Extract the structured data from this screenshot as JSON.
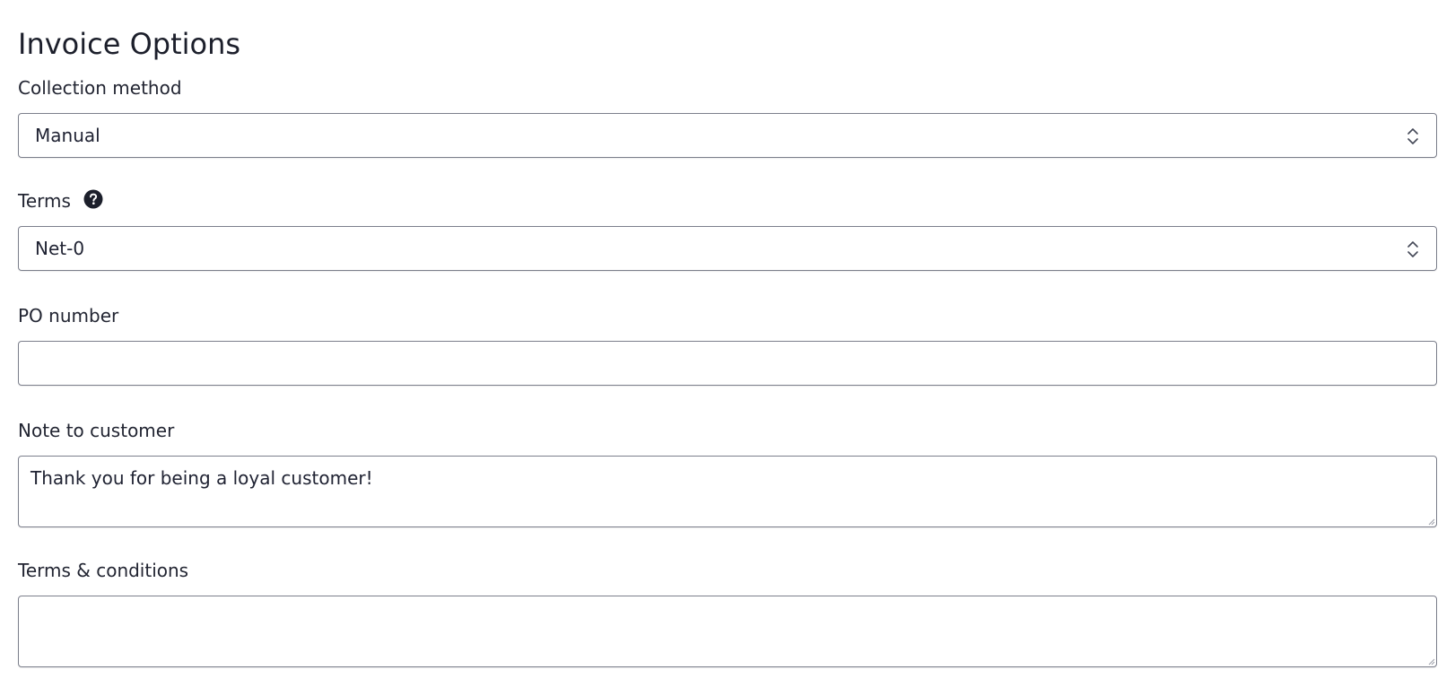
{
  "form": {
    "title": "Invoice Options",
    "collection_method": {
      "label": "Collection method",
      "selected": "Manual"
    },
    "terms": {
      "label": "Terms",
      "selected": "Net-0",
      "help_icon": "question-circle-icon"
    },
    "po_number": {
      "label": "PO number",
      "value": ""
    },
    "note_to_customer": {
      "label": "Note to customer",
      "value": "Thank you for being a loyal customer!"
    },
    "terms_conditions": {
      "label": "Terms & conditions",
      "value": ""
    }
  },
  "colors": {
    "text": "#1f2230",
    "border": "#7c7f8c",
    "icon": "#1c1f2b"
  }
}
